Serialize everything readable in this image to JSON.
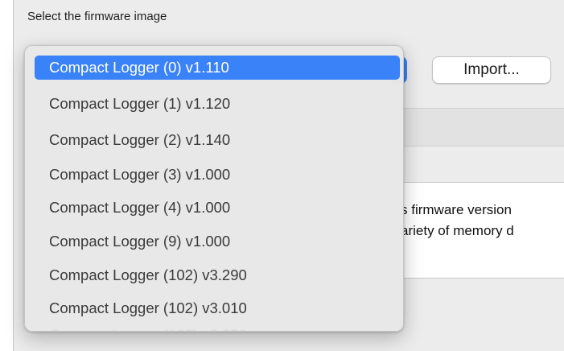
{
  "section_label": "Select the firmware image",
  "import_button": "Import...",
  "description": {
    "line1": "s firmware version",
    "line2": "ariety of memory d"
  },
  "dropdown": {
    "selected_index": 0,
    "items": [
      "Compact Logger (0) v1.110",
      "Compact Logger (1) v1.120",
      "Compact Logger (2) v1.140",
      "Compact Logger (3) v1.000",
      "Compact Logger (4) v1.000",
      "Compact Logger (9) v1.000",
      "Compact Logger (102) v3.290",
      "Compact Logger (102) v3.010"
    ]
  },
  "colors": {
    "accent": "#3a82f7",
    "menu_bg": "#e8e8e8",
    "panel_bg": "#ececec"
  }
}
